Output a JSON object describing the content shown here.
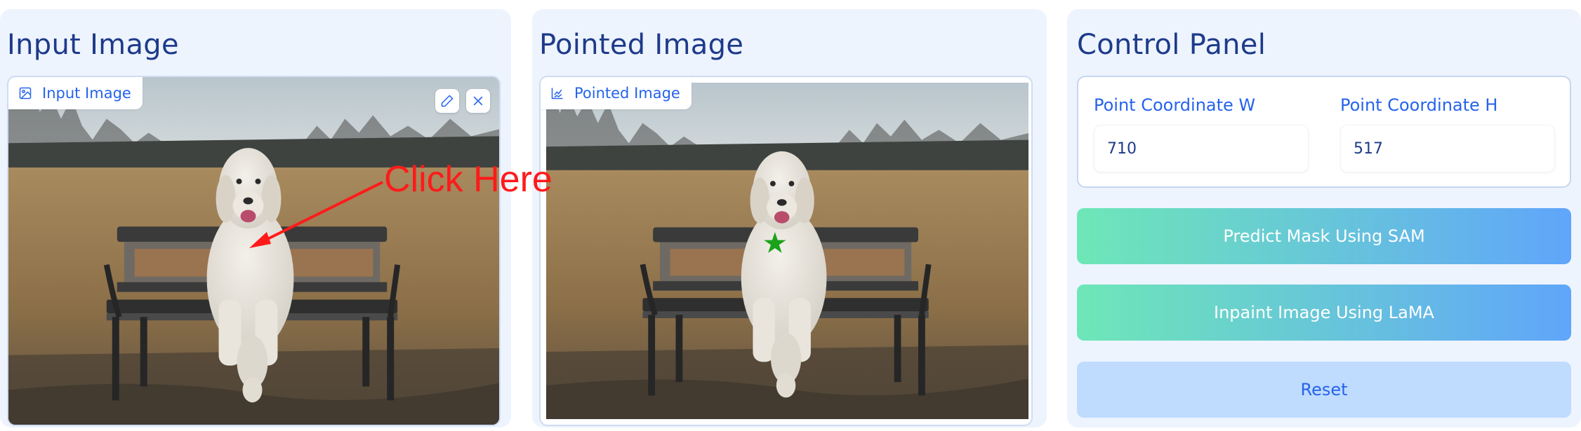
{
  "input_panel": {
    "title": "Input Image",
    "badge_label": "Input Image",
    "annotation_text": "Click Here"
  },
  "pointed_panel": {
    "title": "Pointed Image",
    "badge_label": "Pointed Image"
  },
  "control_panel": {
    "title": "Control Panel",
    "coord_w_label": "Point Coordinate W",
    "coord_w_value": "710",
    "coord_h_label": "Point Coordinate H",
    "coord_h_value": "517",
    "predict_button": "Predict Mask Using SAM",
    "inpaint_button": "Inpaint Image Using LaMA",
    "reset_button": "Reset"
  },
  "icons": {
    "image_icon": "image-icon",
    "chart_icon": "chart-icon",
    "edit_icon": "pencil-icon",
    "close_icon": "close-icon",
    "star_marker": "star-icon"
  },
  "colors": {
    "panel_bg": "#edf4fe",
    "title": "#1e3a8a",
    "accent": "#2563eb",
    "annotation": "#ff1a1a",
    "marker": "#1aa21a",
    "gradient_start": "#6ee7b7",
    "gradient_end": "#60a5fa",
    "reset_bg": "#bfdbfe"
  }
}
